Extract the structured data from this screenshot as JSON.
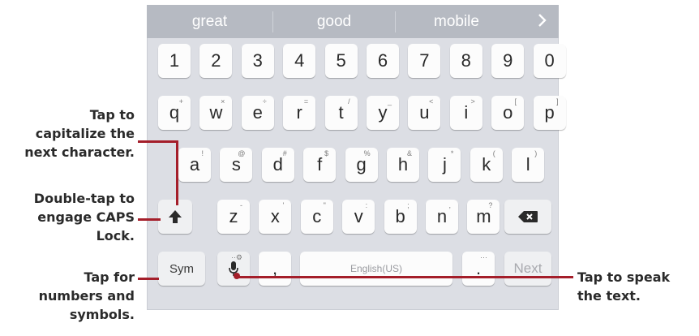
{
  "suggestions": [
    "great",
    "good",
    "mobile"
  ],
  "number_row": [
    "1",
    "2",
    "3",
    "4",
    "5",
    "6",
    "7",
    "8",
    "9",
    "0"
  ],
  "qwerty_row": [
    {
      "key": "q",
      "sub": "+"
    },
    {
      "key": "w",
      "sub": "×"
    },
    {
      "key": "e",
      "sub": "÷"
    },
    {
      "key": "r",
      "sub": "="
    },
    {
      "key": "t",
      "sub": "/"
    },
    {
      "key": "y",
      "sub": "_"
    },
    {
      "key": "u",
      "sub": "<"
    },
    {
      "key": "i",
      "sub": ">"
    },
    {
      "key": "o",
      "sub": "["
    },
    {
      "key": "p",
      "sub": "]"
    }
  ],
  "asdf_row": [
    {
      "key": "a",
      "sub": "!"
    },
    {
      "key": "s",
      "sub": "@"
    },
    {
      "key": "d",
      "sub": "#"
    },
    {
      "key": "f",
      "sub": "$"
    },
    {
      "key": "g",
      "sub": "%"
    },
    {
      "key": "h",
      "sub": "&"
    },
    {
      "key": "j",
      "sub": "*"
    },
    {
      "key": "k",
      "sub": "("
    },
    {
      "key": "l",
      "sub": ")"
    }
  ],
  "zxcv_row": [
    {
      "key": "z",
      "sub": "-"
    },
    {
      "key": "x",
      "sub": "'"
    },
    {
      "key": "c",
      "sub": "\""
    },
    {
      "key": "v",
      "sub": ":"
    },
    {
      "key": "b",
      "sub": ";"
    },
    {
      "key": "n",
      "sub": ","
    },
    {
      "key": "m",
      "sub": "?"
    }
  ],
  "bottom_row": {
    "sym": "Sym",
    "comma": ",",
    "space": "English(US)",
    "period": ".",
    "period_sub": "···",
    "mic_sub": "··⚙",
    "next": "Next"
  },
  "callouts": {
    "shift_tap": [
      "Tap to",
      "capitalize the",
      "next character."
    ],
    "shift_double": [
      "Double-tap to",
      "engage CAPS",
      "Lock."
    ],
    "sym": [
      "Tap for",
      "numbers and",
      "symbols."
    ],
    "mic": [
      "Tap to speak",
      "the text."
    ]
  },
  "colors": {
    "callout_line": "#a41e2a",
    "keyboard_bg": "#dcdee4",
    "suggestion_bar": "#b6bac2"
  },
  "icons": {
    "next_suggestions": "chevron-right-icon",
    "shift": "shift-arrow-icon",
    "backspace": "backspace-icon",
    "mic": "microphone-icon"
  }
}
